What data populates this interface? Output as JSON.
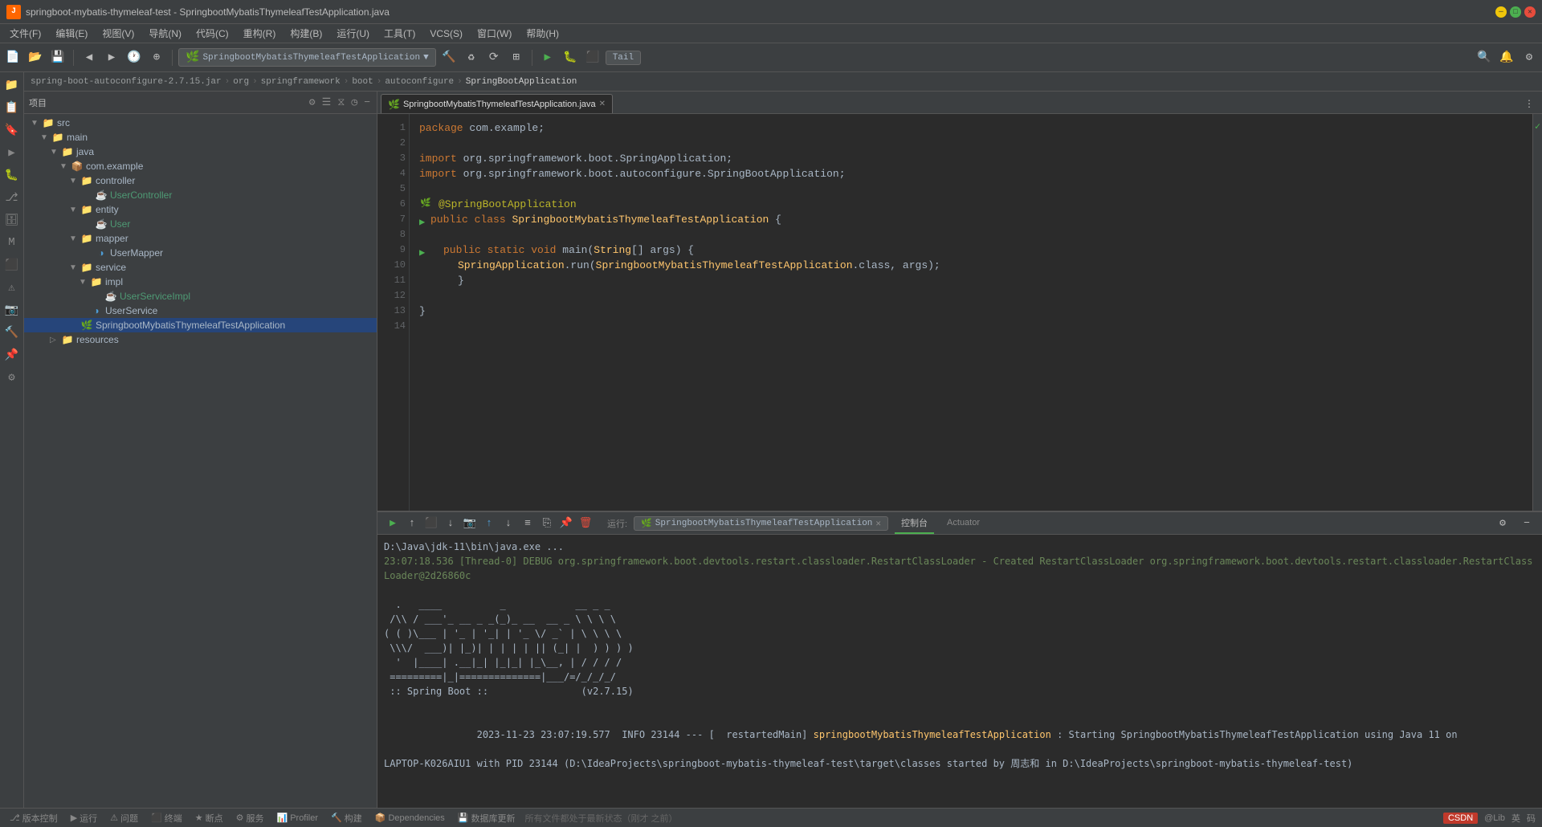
{
  "titlebar": {
    "title": "springboot-mybatis-thymeleaf-test - SpringbootMybatisThymeleafTestApplication.java",
    "icon": "J"
  },
  "menubar": {
    "items": [
      "文件(F)",
      "编辑(E)",
      "视图(V)",
      "导航(N)",
      "代码(C)",
      "重构(R)",
      "构建(B)",
      "运行(U)",
      "工具(T)",
      "VCS(S)",
      "窗口(W)",
      "帮助(H)"
    ]
  },
  "toolbar": {
    "run_config": "SpringbootMybatisThymeleafTestApplication",
    "tail": "Tail"
  },
  "breadcrumb": {
    "items": [
      "spring-boot-autoconfigure-2.7.15.jar",
      "org",
      "springframework",
      "boot",
      "autoconfigure",
      "SpringBootApplication"
    ]
  },
  "editor": {
    "tab": {
      "label": "SpringbootMybatisThymeleafTestApplication.java",
      "modified": false
    },
    "lines": [
      {
        "num": 1,
        "text": "package com.example;",
        "type": "pkg"
      },
      {
        "num": 2,
        "text": "",
        "type": "blank"
      },
      {
        "num": 3,
        "text": "import org.springframework.boot.SpringApplication;",
        "type": "import"
      },
      {
        "num": 4,
        "text": "import org.springframework.boot.autoconfigure.SpringBootApplication;",
        "type": "import"
      },
      {
        "num": 5,
        "text": "",
        "type": "blank"
      },
      {
        "num": 6,
        "text": "@SpringBootApplication",
        "type": "annotation"
      },
      {
        "num": 7,
        "text": "public class SpringbootMybatisThymeleafTestApplication {",
        "type": "class"
      },
      {
        "num": 8,
        "text": "",
        "type": "blank"
      },
      {
        "num": 9,
        "text": "    public static void main(String[] args) {",
        "type": "method"
      },
      {
        "num": 10,
        "text": "        SpringApplication.run(SpringbootMybatisThymeleafTestApplication.class, args);",
        "type": "code"
      },
      {
        "num": 11,
        "text": "    }",
        "type": "code"
      },
      {
        "num": 12,
        "text": "",
        "type": "blank"
      },
      {
        "num": 13,
        "text": "}",
        "type": "code"
      },
      {
        "num": 14,
        "text": "",
        "type": "blank"
      }
    ]
  },
  "sidebar": {
    "header": "项目",
    "tree": [
      {
        "level": 0,
        "label": "src",
        "type": "folder",
        "expanded": true
      },
      {
        "level": 1,
        "label": "main",
        "type": "folder",
        "expanded": true
      },
      {
        "level": 2,
        "label": "java",
        "type": "folder",
        "expanded": true
      },
      {
        "level": 3,
        "label": "com.example",
        "type": "package",
        "expanded": true
      },
      {
        "level": 4,
        "label": "controller",
        "type": "folder",
        "expanded": true
      },
      {
        "level": 5,
        "label": "UserController",
        "type": "java",
        "expanded": false
      },
      {
        "level": 4,
        "label": "entity",
        "type": "folder",
        "expanded": true
      },
      {
        "level": 5,
        "label": "User",
        "type": "java",
        "expanded": false
      },
      {
        "level": 4,
        "label": "mapper",
        "type": "folder",
        "expanded": true
      },
      {
        "level": 5,
        "label": "UserMapper",
        "type": "java",
        "expanded": false
      },
      {
        "level": 4,
        "label": "service",
        "type": "folder",
        "expanded": true
      },
      {
        "level": 5,
        "label": "impl",
        "type": "folder",
        "expanded": true
      },
      {
        "level": 6,
        "label": "UserServiceImpl",
        "type": "java",
        "expanded": false
      },
      {
        "level": 5,
        "label": "UserService",
        "type": "interface",
        "expanded": false
      },
      {
        "level": 4,
        "label": "SpringbootMybatisThymeleafTestApplication",
        "type": "spring",
        "expanded": false
      },
      {
        "level": 3,
        "label": "resources",
        "type": "folder",
        "expanded": false
      }
    ]
  },
  "run_panel": {
    "run_label": "运行:",
    "config_name": "SpringbootMybatisThymeleafTestApplication",
    "tabs": [
      "控制台",
      "Actuator"
    ],
    "active_tab": 0,
    "console_lines": [
      {
        "text": "D:\\Java\\jdk-11\\bin\\java.exe ...",
        "type": "normal"
      },
      {
        "text": "23:07:18.536 [Thread-0] DEBUG org.springframework.boot.devtools.restart.classloader.RestartClassLoader - Created RestartClassLoader org.springframework.boot.devtools.restart.classloader.RestartClassLoader@2d26860c",
        "type": "debug"
      },
      {
        "text": "",
        "type": "blank"
      },
      {
        "text": "  .   ____          _            __ _ _",
        "type": "spring"
      },
      {
        "text": " /\\\\ / ___'_ __ _ _(_)_ __  __ _ \\ \\ \\ \\",
        "type": "spring"
      },
      {
        "text": "( ( )\\___ | '_ | '_| | '_ \\/ _` | \\ \\ \\ \\",
        "type": "spring"
      },
      {
        "text": " \\\\/  ___)| |_)| | | | | || (_| |  ) ) ) )",
        "type": "spring"
      },
      {
        "text": "  '  |____| .__|_| |_|_| |_\\__, | / / / /",
        "type": "spring"
      },
      {
        "text": " =========|_|==============|___/=/_/_/_/",
        "type": "spring"
      },
      {
        "text": " :: Spring Boot ::                (v2.7.15)",
        "type": "spring"
      },
      {
        "text": "",
        "type": "blank"
      },
      {
        "text": "2023-11-23 23:07:19.577  INFO 23144 --- [  restartedMain] springbootMybatisThymeleafTestApplication : Starting SpringbootMybatisThymeleafTestApplication using Java 11 on LAPTOP-K026AIU1 with PID 23144 (D:\\IdeaProjects\\springboot-mybatis-thymeleaf-test\\target\\classes started by 周志和 in D:\\IdeaProjects\\springboot-mybatis-thymeleaf-test)",
        "type": "info"
      }
    ]
  },
  "statusbar": {
    "items": [
      "版本控制",
      "▶ 运行",
      "⚠ 问题",
      "⬛ 终端",
      "★ 断点",
      "⚙ 服务",
      "📊 Profiler",
      "🔨 构建",
      "📦 Dependencies",
      "💾 数据库更新"
    ],
    "status_text": "所有文件都处于最新状态（刚才 之前）",
    "right_items": [
      "CSDN",
      "@Lib",
      "英",
      "码"
    ]
  }
}
